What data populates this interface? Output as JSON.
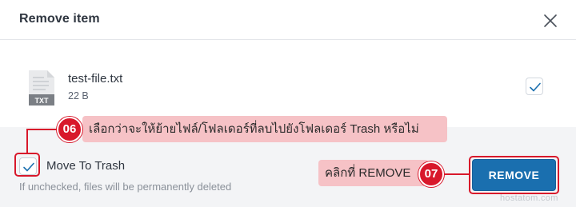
{
  "dialog": {
    "title": "Remove item",
    "close_icon": "close-icon"
  },
  "file": {
    "name": "test-file.txt",
    "size": "22 B",
    "type_badge": "TXT",
    "icon": "text-file-icon",
    "selected": true
  },
  "move_to_trash": {
    "label": "Move To Trash",
    "help": "If unchecked, files will be permanently deleted",
    "checked": true
  },
  "remove_button": {
    "label": "REMOVE"
  },
  "annotations": [
    {
      "step": "06",
      "text": "เลือกว่าจะให้ย้ายไฟล์/โฟลเดอร์ที่ลบไปยังโฟลเดอร์ Trash หรือไม่"
    },
    {
      "step": "07",
      "text": "คลิกที่ REMOVE"
    }
  ],
  "watermark": "hostatom.com",
  "colors": {
    "accent_blue": "#1a6faf",
    "annotation_red": "#d8182b",
    "annotation_pink": "#f6c2c6",
    "footer_bg": "#f3f4f6"
  }
}
